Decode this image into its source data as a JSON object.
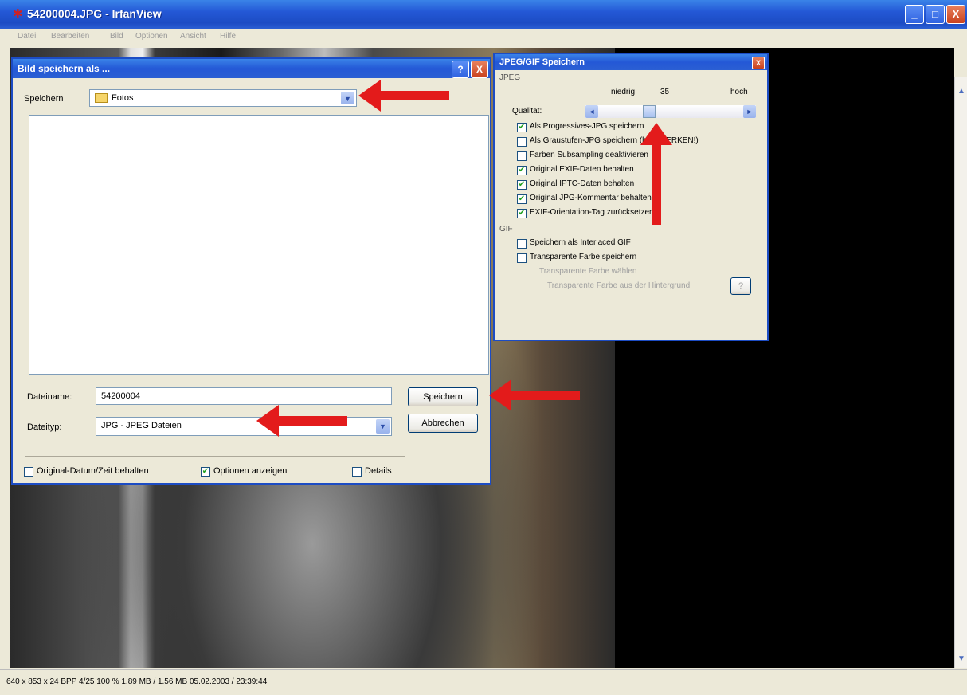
{
  "window": {
    "title": "54200004.JPG - IrfanView",
    "minimize_label": "_",
    "maximize_label": "□",
    "close_label": "X"
  },
  "menu": [
    "Datei",
    "Bearbeiten",
    "Bild",
    "Optionen",
    "Ansicht",
    "Hilfe"
  ],
  "status": "640 x 853 x 24 BPP    4/25    100 %    1.89 MB / 1.56 MB    05.02.2003 / 23:39:44",
  "save_dialog": {
    "title": "Bild speichern als ...",
    "help_label": "?",
    "close_label": "X",
    "save_in_label": "Speichern",
    "folder": "Fotos",
    "filename_label": "Dateiname:",
    "filename_value": "54200004",
    "filetype_label": "Dateityp:",
    "filetype_value": "JPG - JPEG Dateien",
    "save_button": "Speichern",
    "cancel_button": "Abbrechen",
    "options": [
      {
        "label": "Original-Datum/Zeit behalten",
        "checked": false
      },
      {
        "label": "Optionen anzeigen",
        "checked": true
      },
      {
        "label": "Details",
        "checked": false
      }
    ]
  },
  "jpg_dialog": {
    "title": "JPEG/GIF Speichern",
    "close_label": "X",
    "jpeg_group": "JPEG",
    "low_label": "niedrig",
    "quality_value": "35",
    "high_label": "hoch",
    "quality_label": "Qualität:",
    "jpeg_options": [
      {
        "label": "Als Progressives-JPG speichern",
        "checked": true
      },
      {
        "label": "Als Graustufen-JPG speichern (bitte MERKEN!)",
        "checked": false
      },
      {
        "label": "Farben Subsampling deaktivieren",
        "checked": false
      },
      {
        "label": "Original EXIF-Daten behalten",
        "checked": true
      },
      {
        "label": "Original IPTC-Daten behalten",
        "checked": true
      },
      {
        "label": "Original JPG-Kommentar behalten",
        "checked": true
      },
      {
        "label": "EXIF-Orientation-Tag zurücksetzen",
        "checked": true
      }
    ],
    "gif_group": "GIF",
    "gif_options": [
      {
        "label": "Speichern als Interlaced GIF",
        "checked": false
      },
      {
        "label": "Transparente Farbe speichern",
        "checked": false
      }
    ],
    "radio_label": "Transparente Farbe wählen",
    "transparent_label": "Transparente Farbe aus der Hintergrund",
    "help_button": "?"
  },
  "scroll": {
    "up": "▲",
    "down": "▼"
  },
  "arrow_color": "#E31B1B"
}
